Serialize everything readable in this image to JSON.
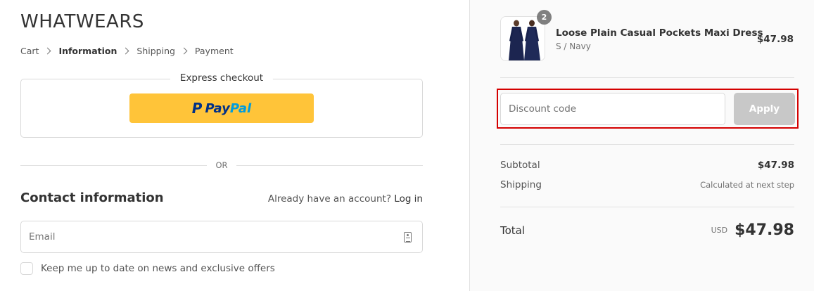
{
  "brand": "WHATWEARS",
  "breadcrumb": {
    "cart": "Cart",
    "information": "Information",
    "shipping": "Shipping",
    "payment": "Payment"
  },
  "express": {
    "title": "Express checkout",
    "paypal_p": "P",
    "paypal_pay": "Pay",
    "paypal_pal": "Pal"
  },
  "divider": "OR",
  "contact": {
    "title": "Contact information",
    "account_prompt": "Already have an account?",
    "login_link": "Log in",
    "email_placeholder": "Email",
    "newsletter_label": "Keep me up to date on news and exclusive offers"
  },
  "order": {
    "item": {
      "name": "Loose Plain Casual Pockets Maxi Dress",
      "variant": "S / Navy",
      "price": "$47.98",
      "quantity": "2"
    },
    "discount": {
      "placeholder": "Discount code",
      "apply_label": "Apply"
    },
    "subtotal_label": "Subtotal",
    "subtotal_value": "$47.98",
    "shipping_label": "Shipping",
    "shipping_value": "Calculated at next step",
    "total_label": "Total",
    "currency": "USD",
    "total_value": "$47.98"
  },
  "colors": {
    "paypal_yellow": "#ffc439",
    "paypal_dark_blue": "#003087",
    "paypal_light_blue": "#009cde",
    "highlight_red": "#d40000",
    "apply_disabled": "#c8c8c8"
  }
}
